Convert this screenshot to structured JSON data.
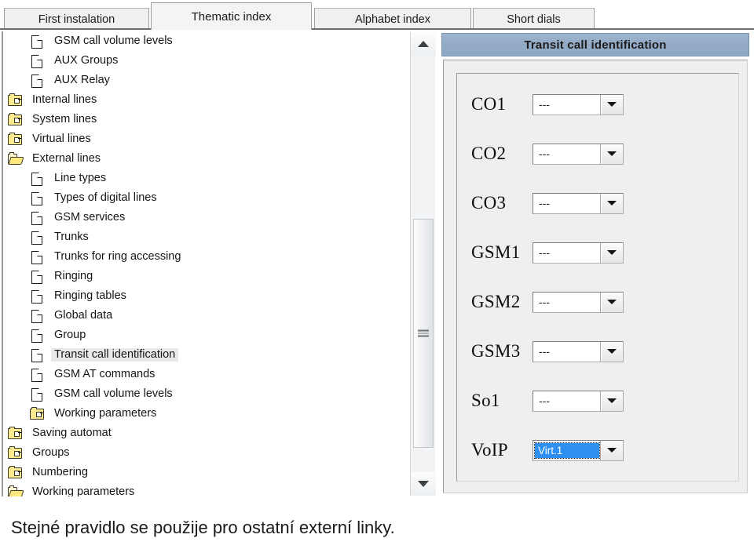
{
  "tabs": [
    {
      "label": "First instalation",
      "active": false
    },
    {
      "label": "Thematic index",
      "active": true
    },
    {
      "label": "Alphabet index",
      "active": false
    },
    {
      "label": "Short dials",
      "active": false
    }
  ],
  "tree": {
    "items": [
      {
        "label": "GSM call volume levels",
        "icon": "document-icon",
        "depth": 1,
        "selected": false
      },
      {
        "label": "AUX Groups",
        "icon": "document-icon",
        "depth": 1,
        "selected": false
      },
      {
        "label": "AUX Relay",
        "icon": "document-icon",
        "depth": 1,
        "selected": false
      },
      {
        "label": "Internal lines",
        "icon": "folder-closed-icon",
        "depth": 0,
        "selected": false
      },
      {
        "label": "System lines",
        "icon": "folder-closed-icon",
        "depth": 0,
        "selected": false
      },
      {
        "label": "Virtual lines",
        "icon": "folder-closed-icon",
        "depth": 0,
        "selected": false
      },
      {
        "label": "External lines",
        "icon": "folder-open-icon",
        "depth": 0,
        "selected": false
      },
      {
        "label": "Line types",
        "icon": "document-icon",
        "depth": 1,
        "selected": false
      },
      {
        "label": "Types of  digital lines",
        "icon": "document-icon",
        "depth": 1,
        "selected": false
      },
      {
        "label": "GSM services",
        "icon": "document-icon",
        "depth": 1,
        "selected": false
      },
      {
        "label": "Trunks",
        "icon": "document-icon",
        "depth": 1,
        "selected": false
      },
      {
        "label": "Trunks for ring accessing",
        "icon": "document-icon",
        "depth": 1,
        "selected": false
      },
      {
        "label": "Ringing",
        "icon": "document-icon",
        "depth": 1,
        "selected": false
      },
      {
        "label": "Ringing tables",
        "icon": "document-icon",
        "depth": 1,
        "selected": false
      },
      {
        "label": "Global data",
        "icon": "document-icon",
        "depth": 1,
        "selected": false
      },
      {
        "label": "Group",
        "icon": "document-icon",
        "depth": 1,
        "selected": false
      },
      {
        "label": "Transit call identification",
        "icon": "document-icon",
        "depth": 1,
        "selected": true
      },
      {
        "label": "GSM AT commands",
        "icon": "document-icon",
        "depth": 1,
        "selected": false
      },
      {
        "label": "GSM call volume levels",
        "icon": "document-icon",
        "depth": 1,
        "selected": false
      },
      {
        "label": "Working parameters",
        "icon": "folder-closed-icon",
        "depth": 1,
        "selected": false
      },
      {
        "label": "Saving automat",
        "icon": "folder-closed-icon",
        "depth": 0,
        "selected": false
      },
      {
        "label": "Groups",
        "icon": "folder-closed-icon",
        "depth": 0,
        "selected": false
      },
      {
        "label": "Numbering",
        "icon": "folder-closed-icon",
        "depth": 0,
        "selected": false
      },
      {
        "label": "Working parameters",
        "icon": "folder-open-icon",
        "depth": 0,
        "selected": false
      }
    ]
  },
  "scrollbar": {
    "up_arrow": "scroll-up-arrow",
    "down_arrow": "scroll-down-arrow"
  },
  "panel": {
    "title": "Transit call identification",
    "fields": [
      {
        "label": "CO1",
        "value": "---",
        "focused": false
      },
      {
        "label": "CO2",
        "value": "---",
        "focused": false
      },
      {
        "label": "CO3",
        "value": "---",
        "focused": false
      },
      {
        "label": "GSM1",
        "value": "---",
        "focused": false
      },
      {
        "label": "GSM2",
        "value": "---",
        "focused": false
      },
      {
        "label": "GSM3",
        "value": "---",
        "focused": false
      },
      {
        "label": "So1",
        "value": "---",
        "focused": false
      },
      {
        "label": "VoIP",
        "value": "Virt.1",
        "focused": true
      }
    ]
  },
  "caption": {
    "text": "Stejné pravidlo se použije pro ostatní externí linky."
  },
  "colors": {
    "panel_header": "#93abc6",
    "selection_blue": "#2f8ff0",
    "folder_yellow": "#ffeb8f",
    "tree_selection": "#e9e9e9"
  }
}
